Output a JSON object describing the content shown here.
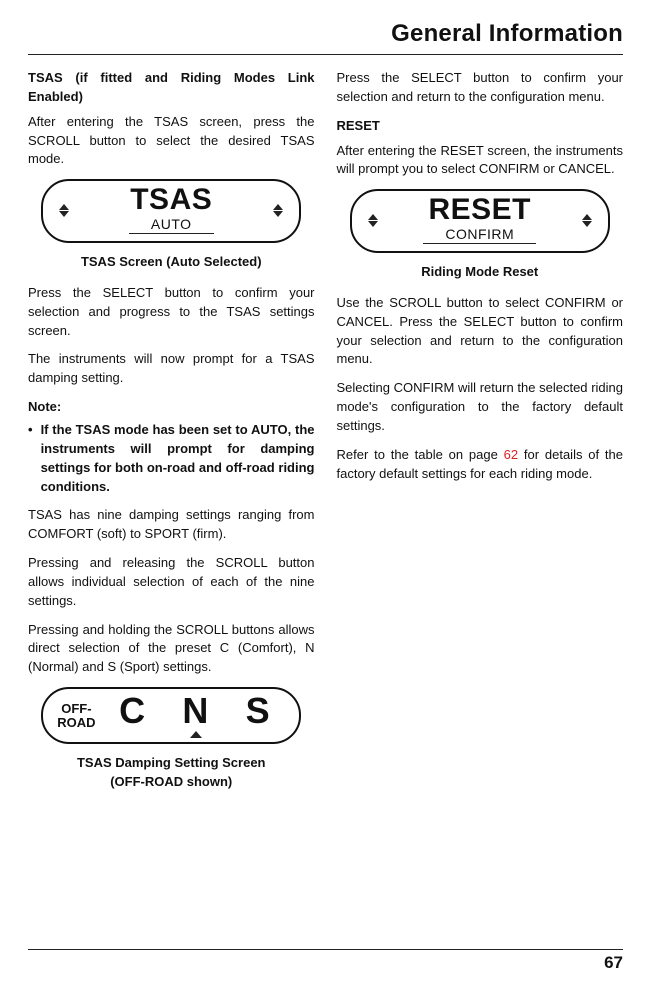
{
  "header": {
    "title": "General Information"
  },
  "page_number": "67",
  "left": {
    "section1_title": "TSAS (if fitted and Riding Modes Link Enabled)",
    "p1": "After entering the TSAS screen, press the SCROLL button to select the desired TSAS mode.",
    "panel1": {
      "big": "TSAS",
      "sub": "AUTO"
    },
    "caption1": "TSAS Screen (Auto Selected)",
    "p2": "Press the SELECT button to confirm your selection and progress to the TSAS settings screen.",
    "p3": "The instruments will now prompt for a TSAS damping setting.",
    "note_label": "Note:",
    "note_bullet": "If the TSAS mode has been set to AUTO, the instruments will prompt for damping settings for both on‑road and off‑road riding conditions.",
    "p4": "TSAS has nine damping settings ranging from COMFORT (soft) to SPORT (firm).",
    "p5": "Pressing and releasing the SCROLL button allows individual selection of each of the nine settings.",
    "p6": "Pressing and holding the SCROLL buttons allows direct selection of the preset C (Comfort), N (Normal) and S (Sport) settings.",
    "panel2": {
      "side_line1": "OFF-",
      "side_line2": "ROAD",
      "a": "C",
      "b": "N",
      "c": "S"
    },
    "caption2a": "TSAS Damping Setting Screen",
    "caption2b": "(OFF-ROAD shown)"
  },
  "right": {
    "p1": "Press the SELECT button to confirm your selection and return to the configuration menu.",
    "section2_title": "RESET",
    "p2": "After entering the RESET screen, the instruments will prompt you to select CONFIRM or CANCEL.",
    "panel3": {
      "big": "RESET",
      "sub": "CONFIRM"
    },
    "caption1": "Riding Mode Reset",
    "p3": "Use the SCROLL button to select CONFIRM or CANCEL. Press the SELECT button to confirm your selection and return to the configuration menu.",
    "p4": "Selecting CONFIRM will return the selected riding mode's configuration to the factory default settings.",
    "p5a": "Refer to the table on page ",
    "p5_link": "62",
    "p5b": " for details of the factory default settings for each riding mode."
  }
}
